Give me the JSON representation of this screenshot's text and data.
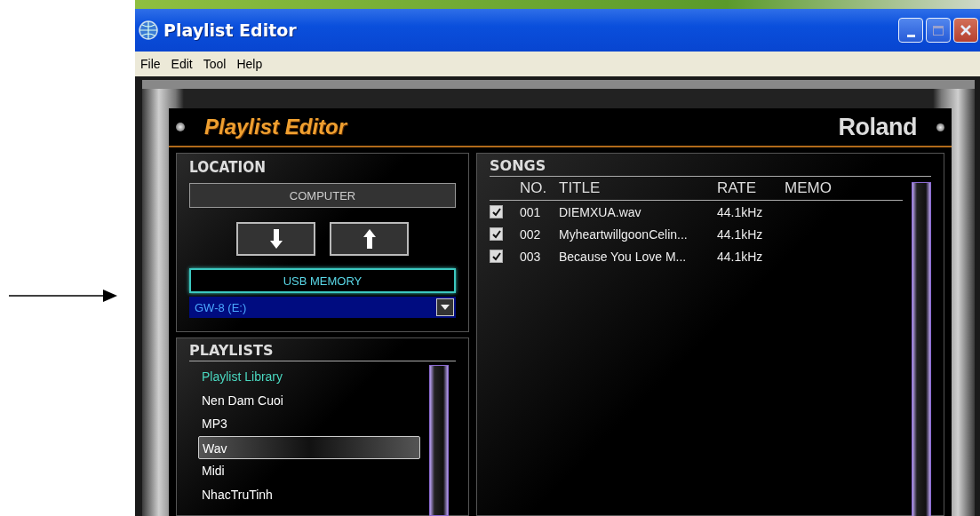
{
  "window": {
    "title": "Playlist Editor"
  },
  "menu": [
    "File",
    "Edit",
    "Tool",
    "Help"
  ],
  "app": {
    "title": "Playlist Editor",
    "brand": "Roland"
  },
  "location": {
    "title": "LOCATION",
    "computer": "COMPUTER",
    "usb": "USB MEMORY",
    "drive": "GW-8 (E:)"
  },
  "playlists": {
    "title": "PLAYLISTS",
    "items": [
      {
        "label": "Playlist Library",
        "kind": "library",
        "selected": false
      },
      {
        "label": "Nen Dam Cuoi",
        "kind": "playlist",
        "selected": false
      },
      {
        "label": "MP3",
        "kind": "playlist",
        "selected": false
      },
      {
        "label": "Wav",
        "kind": "playlist",
        "selected": true
      },
      {
        "label": "Midi",
        "kind": "playlist",
        "selected": false
      },
      {
        "label": "NhacTruTinh",
        "kind": "playlist",
        "selected": false
      }
    ]
  },
  "songs": {
    "title": "SONGS",
    "columns": [
      "NO.",
      "TITLE",
      "RATE",
      "MEMO"
    ],
    "rows": [
      {
        "checked": true,
        "no": "001",
        "title": "DIEMXUA.wav",
        "rate": "44.1kHz"
      },
      {
        "checked": true,
        "no": "002",
        "title": "MyheartwillgoonCelin...",
        "rate": "44.1kHz"
      },
      {
        "checked": true,
        "no": "003",
        "title": "Because You Love M...",
        "rate": "44.1kHz"
      }
    ]
  }
}
